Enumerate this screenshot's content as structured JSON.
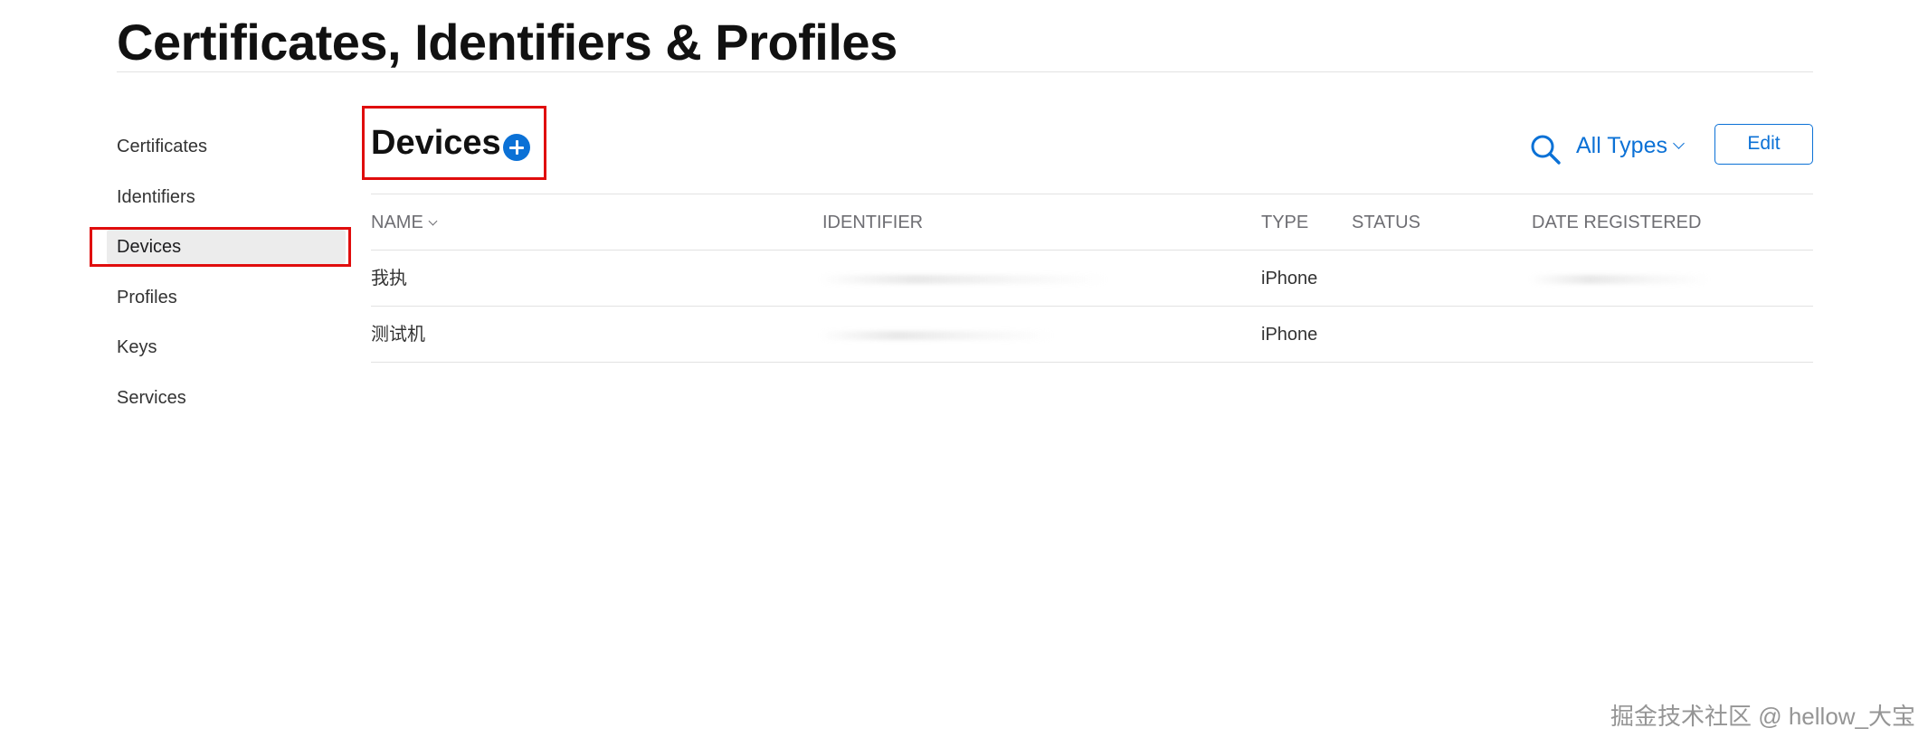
{
  "page": {
    "title": "Certificates, Identifiers & Profiles"
  },
  "sidebar": {
    "items": [
      {
        "label": "Certificates",
        "active": false
      },
      {
        "label": "Identifiers",
        "active": false
      },
      {
        "label": "Devices",
        "active": true
      },
      {
        "label": "Profiles",
        "active": false
      },
      {
        "label": "Keys",
        "active": false
      },
      {
        "label": "Services",
        "active": false
      }
    ]
  },
  "section": {
    "title": "Devices",
    "add_icon": "plus-circle-icon",
    "search_icon": "search-icon",
    "filter_label": "All Types",
    "edit_label": "Edit"
  },
  "table": {
    "headers": {
      "name": "NAME",
      "identifier": "IDENTIFIER",
      "type": "TYPE",
      "status": "STATUS",
      "date_registered": "DATE REGISTERED"
    },
    "rows": [
      {
        "name": "我执",
        "identifier": "",
        "type": "iPhone",
        "status": "",
        "date_registered": ""
      },
      {
        "name": "测试机",
        "identifier": "",
        "type": "iPhone",
        "status": "",
        "date_registered": ""
      }
    ]
  },
  "colors": {
    "accent": "#0b71d6",
    "highlight": "#e00d0d"
  },
  "watermark": "掘金技术社区 @ hellow_大宝"
}
